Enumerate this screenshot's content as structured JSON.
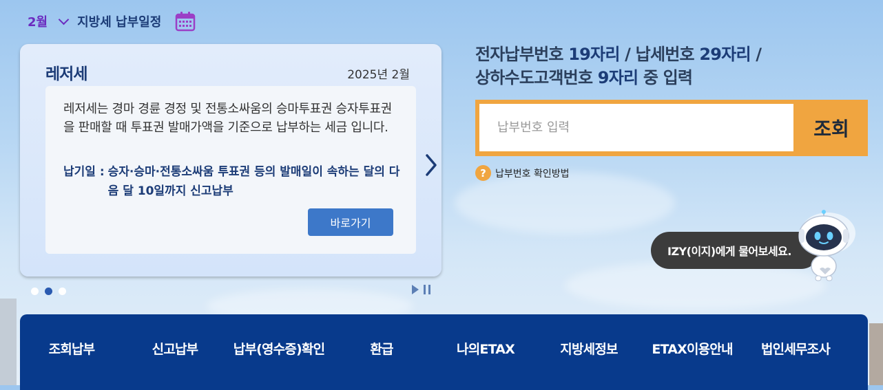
{
  "schedule": {
    "month": "2월",
    "title": "지방세 납부일정"
  },
  "card": {
    "title": "레저세",
    "date": "2025년 2월",
    "description": "레저세는 경마 경륜 경정 및 전통소싸움의 승마투표권 승자투표권을 판매할 때 투표권 발매가액을 기준으로 납부하는 세금 입니다.",
    "due_label": "납기일 :",
    "due_text": "승자·승마·전통소싸움 투표권 등의 발매일이 속하는 달의 다음 달 10일까지 신고납부",
    "go_button": "바로가기"
  },
  "slider": {
    "total": 3,
    "active_index": 1
  },
  "payment": {
    "title_part1": "전자납부번호 ",
    "title_num1": "19자리",
    "title_part2": " / 납세번호 ",
    "title_num2": "29자리",
    "title_part3": " /",
    "title_part4": "상하수도고객번호 ",
    "title_num3": "9자리",
    "title_part5": " 중 입력",
    "placeholder": "납부번호 입력",
    "search_button": "조회",
    "help_icon": "?",
    "help_text": "납부번호 확인방법"
  },
  "chatbot": {
    "bubble": "IZY(이지)에게 물어보세요."
  },
  "nav": {
    "items": [
      "조회납부",
      "신고납부",
      "납부(영수증)확인",
      "환급",
      "나의ETAX",
      "지방세정보",
      "ETAX이용안내",
      "법인세무조사"
    ]
  },
  "colors": {
    "accent_orange": "#f0a540",
    "nav_blue": "#083a8c",
    "button_blue": "#3d78c9",
    "month_purple": "#6b2bbf"
  }
}
